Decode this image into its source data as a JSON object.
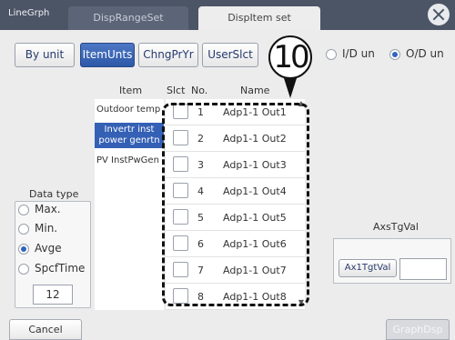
{
  "window": {
    "app_tab": "LineGrph",
    "tabs": [
      {
        "label": "DispRangeSet"
      },
      {
        "label": "DispItem set"
      }
    ]
  },
  "toolbar": {
    "buttons": [
      {
        "label": "By unit"
      },
      {
        "label": "ItemUnts"
      },
      {
        "label": "ChngPrYr"
      },
      {
        "label": "UserSlct"
      }
    ],
    "radios": [
      {
        "label": "I/D un",
        "selected": false
      },
      {
        "label": "O/D un",
        "selected": true
      }
    ]
  },
  "callout": {
    "number": "10"
  },
  "list": {
    "headers": {
      "item": "Item",
      "slct": "Slct",
      "no": "No.",
      "name": "Name"
    },
    "items": [
      {
        "label": "Outdoor temp"
      },
      {
        "label": "Invertr inst power genrtn"
      },
      {
        "label": "PV InstPwGen"
      }
    ],
    "rows": [
      {
        "no": "1",
        "name": "Adp1-1 Out1"
      },
      {
        "no": "2",
        "name": "Adp1-1 Out2"
      },
      {
        "no": "3",
        "name": "Adp1-1 Out3"
      },
      {
        "no": "4",
        "name": "Adp1-1 Out4"
      },
      {
        "no": "5",
        "name": "Adp1-1 Out5"
      },
      {
        "no": "6",
        "name": "Adp1-1 Out6"
      },
      {
        "no": "7",
        "name": "Adp1-1 Out7"
      },
      {
        "no": "8",
        "name": "Adp1-1 Out8"
      }
    ]
  },
  "data_type": {
    "title": "Data type",
    "options": [
      {
        "label": "Max.",
        "selected": false
      },
      {
        "label": "Min.",
        "selected": false
      },
      {
        "label": "Avge",
        "selected": true
      },
      {
        "label": "SpcfTime",
        "selected": false
      }
    ],
    "value": "12"
  },
  "axis_target": {
    "title": "AxsTgVal",
    "button_label": "Ax1TgtVal",
    "value": ""
  },
  "bottom": {
    "cancel_label": "Cancel",
    "graph_label": "GraphDsp"
  }
}
